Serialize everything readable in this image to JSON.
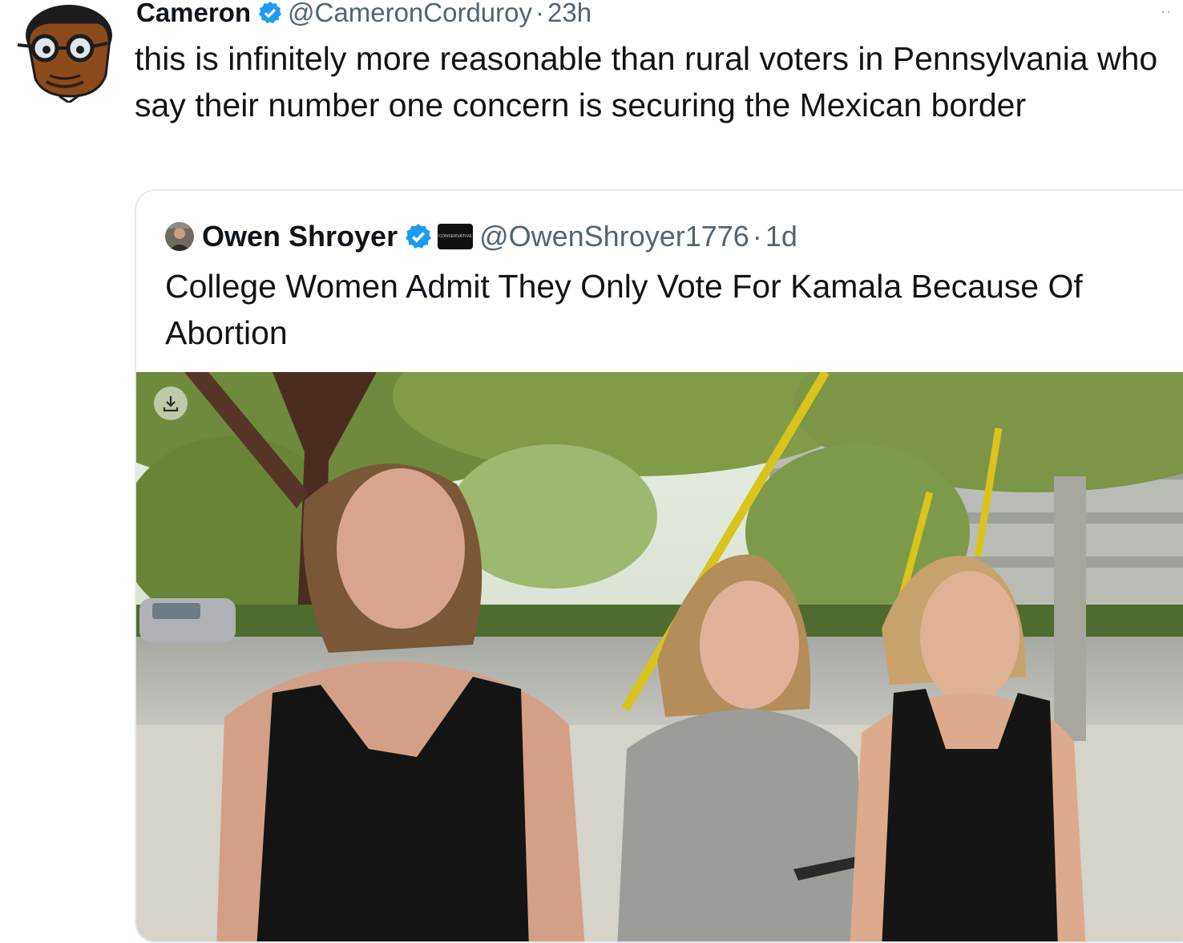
{
  "tweet": {
    "author": {
      "name": "Cameron",
      "handle": "@CameronCorduroy",
      "separator": "·",
      "time": "23h"
    },
    "more_label": "··",
    "text": "this is infinitely more reasonable than rural voters in Pennsylvania who say their number one concern is securing the Mexican border"
  },
  "quote": {
    "author": {
      "name": "Owen Shroyer",
      "badge_text": "CONSERVATIVE",
      "handle": "@OwenShroyer1776",
      "separator": "·",
      "time": "1d"
    },
    "text": "College Women Admit They Only Vote For Kamala Because Of Abortion"
  },
  "colors": {
    "text": "#0f1419",
    "secondary": "#536471",
    "verified": "#1d9bf0",
    "border": "#e6e9ec"
  },
  "icons": {
    "verified": "verified-badge-icon",
    "download": "download-icon",
    "more": "more-icon"
  }
}
